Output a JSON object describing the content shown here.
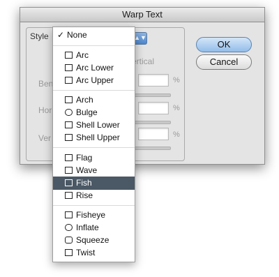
{
  "dialog": {
    "title": "Warp Text",
    "style_label": "Style",
    "orientation_fragment": "ertical",
    "bend_label": "Ben",
    "horizontal_label": "Hor",
    "vertical_label": "Ver",
    "percent_sign": "%",
    "ok_label": "OK",
    "cancel_label": "Cancel"
  },
  "menu": {
    "check_mark": "✓",
    "selected": "Fish",
    "items": [
      {
        "label": "None",
        "icon": "none"
      },
      {
        "label": "Arc",
        "icon": "arc-icon"
      },
      {
        "label": "Arc Lower",
        "icon": "arc-lower-icon"
      },
      {
        "label": "Arc Upper",
        "icon": "arc-upper-icon"
      },
      {
        "label": "Arch",
        "icon": "arch-icon"
      },
      {
        "label": "Bulge",
        "icon": "bulge-icon"
      },
      {
        "label": "Shell Lower",
        "icon": "shell-lower-icon"
      },
      {
        "label": "Shell Upper",
        "icon": "shell-upper-icon"
      },
      {
        "label": "Flag",
        "icon": "flag-icon"
      },
      {
        "label": "Wave",
        "icon": "wave-icon"
      },
      {
        "label": "Fish",
        "icon": "fish-icon"
      },
      {
        "label": "Rise",
        "icon": "rise-icon"
      },
      {
        "label": "Fisheye",
        "icon": "fisheye-icon"
      },
      {
        "label": "Inflate",
        "icon": "inflate-icon"
      },
      {
        "label": "Squeeze",
        "icon": "squeeze-icon"
      },
      {
        "label": "Twist",
        "icon": "twist-icon"
      }
    ]
  },
  "colors": {
    "selection": "#4b5865",
    "ok_button": "#92bde9"
  }
}
